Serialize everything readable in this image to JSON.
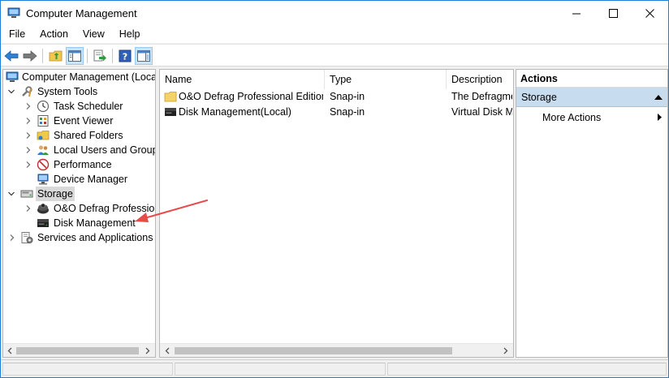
{
  "window": {
    "title": "Computer Management",
    "app_icon": "computer-management-icon",
    "controls": [
      "minimize-icon",
      "maximize-icon",
      "close-icon"
    ]
  },
  "menu": {
    "items": [
      "File",
      "Action",
      "View",
      "Help"
    ]
  },
  "toolbar": {
    "buttons": [
      "back-arrow-icon",
      "forward-arrow-icon",
      "up-folder-icon",
      "show-hide-console-tree-icon",
      "export-list-icon",
      "help-icon",
      "show-hide-action-pane-icon"
    ]
  },
  "tree": {
    "root": "Computer Management (Local",
    "system_tools": "System Tools",
    "task_scheduler": "Task Scheduler",
    "event_viewer": "Event Viewer",
    "shared_folders": "Shared Folders",
    "local_users": "Local Users and Groups",
    "performance": "Performance",
    "device_manager": "Device Manager",
    "storage": "Storage",
    "oo_defrag": "O&O Defrag Profession",
    "disk_management": "Disk Management",
    "services": "Services and Applications"
  },
  "list": {
    "columns": [
      "Name",
      "Type",
      "Description"
    ],
    "rows": [
      {
        "name": "O&O Defrag Professional Edition",
        "type": "Snap-in",
        "description": "The Defragme"
      },
      {
        "name": "Disk Management(Local)",
        "type": "Snap-in",
        "description": "Virtual Disk M"
      }
    ]
  },
  "actions": {
    "header": "Actions",
    "section": "Storage",
    "item": "More Actions"
  },
  "colors": {
    "window_border": "#1f7fd6",
    "actions_section_bg": "#c8dcef",
    "annotation_arrow": "#e84a4a",
    "selection_bg": "#d9d9d9"
  }
}
